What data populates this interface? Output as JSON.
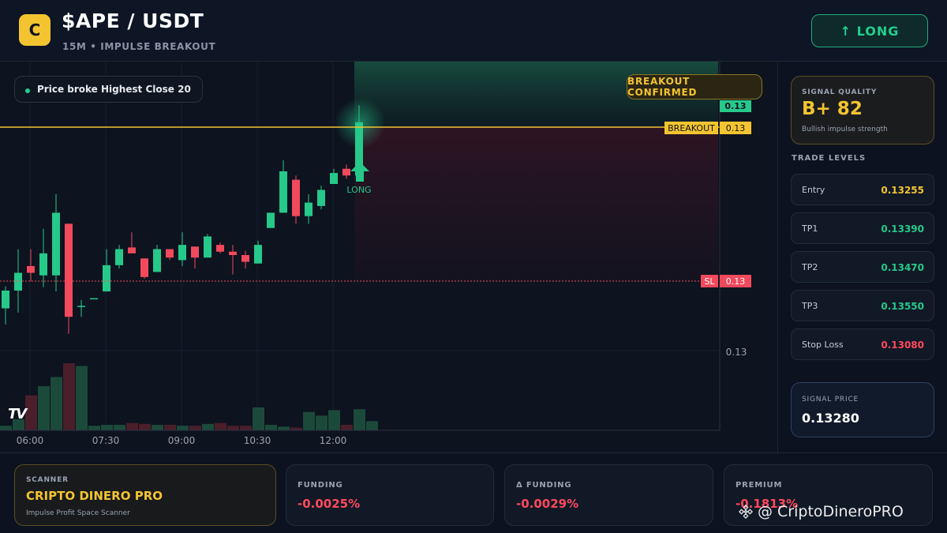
{
  "header": {
    "logo_letter": "C",
    "pair": "$APE / USDT",
    "subtitle": "15M • IMPULSE BREAKOUT",
    "long_button": "↑ LONG"
  },
  "chart": {
    "pill_text": "Price broke Highest Close 20",
    "confirm_badge": "BREAKOUT CONFIRMED",
    "tv_logo": "TV",
    "long_marker": "LONG",
    "price_tag_top": "0.13",
    "breakout_tag": "BREAKOUT",
    "breakout_value": "0.13",
    "sl_tag": "SL",
    "sl_value": "0.13",
    "axis_price": "0.13",
    "time_labels": [
      "06:00",
      "07:30",
      "09:00",
      "10:30",
      "12:00"
    ],
    "colors": {
      "up": "#26c98a",
      "down": "#f2495c",
      "breakout": "#f4c430"
    }
  },
  "chart_data": {
    "type": "candlestick",
    "title": "",
    "interval": "15m",
    "x_ticks": [
      "06:00",
      "07:30",
      "09:00",
      "10:30",
      "12:00"
    ],
    "y_tick": "0.13",
    "breakout_level": 0.13,
    "stop_loss_level": 0.13,
    "candles": [
      {
        "o": 0.13205,
        "h": 0.13231,
        "l": 0.13186,
        "c": 0.13226
      },
      {
        "o": 0.13226,
        "h": 0.13275,
        "l": 0.132,
        "c": 0.13247
      },
      {
        "o": 0.13255,
        "h": 0.13275,
        "l": 0.13237,
        "c": 0.13247
      },
      {
        "o": 0.13244,
        "h": 0.13299,
        "l": 0.1323,
        "c": 0.1327
      },
      {
        "o": 0.13244,
        "h": 0.1334,
        "l": 0.13225,
        "c": 0.13318
      },
      {
        "o": 0.13305,
        "h": 0.13305,
        "l": 0.13175,
        "c": 0.13195
      },
      {
        "o": 0.13208,
        "h": 0.13215,
        "l": 0.13195,
        "c": 0.13208
      },
      {
        "o": 0.13217,
        "h": 0.13217,
        "l": 0.13217,
        "c": 0.13217
      },
      {
        "o": 0.13225,
        "h": 0.13275,
        "l": 0.13225,
        "c": 0.13256
      },
      {
        "o": 0.13256,
        "h": 0.1328,
        "l": 0.13252,
        "c": 0.13275
      },
      {
        "o": 0.13277,
        "h": 0.13295,
        "l": 0.1327,
        "c": 0.1327
      },
      {
        "o": 0.13264,
        "h": 0.13264,
        "l": 0.1324,
        "c": 0.13242
      },
      {
        "o": 0.13248,
        "h": 0.1328,
        "l": 0.13248,
        "c": 0.13275
      },
      {
        "o": 0.13275,
        "h": 0.1327,
        "l": 0.13262,
        "c": 0.13265
      },
      {
        "o": 0.13262,
        "h": 0.13295,
        "l": 0.13255,
        "c": 0.1328
      },
      {
        "o": 0.13278,
        "h": 0.1327,
        "l": 0.13252,
        "c": 0.13265
      },
      {
        "o": 0.13265,
        "h": 0.13293,
        "l": 0.13265,
        "c": 0.1329
      },
      {
        "o": 0.1328,
        "h": 0.13283,
        "l": 0.1327,
        "c": 0.13272
      },
      {
        "o": 0.13272,
        "h": 0.1328,
        "l": 0.13245,
        "c": 0.13268
      },
      {
        "o": 0.13268,
        "h": 0.13273,
        "l": 0.13252,
        "c": 0.1326
      },
      {
        "o": 0.13258,
        "h": 0.13285,
        "l": 0.13258,
        "c": 0.1328
      },
      {
        "o": 0.133,
        "h": 0.13318,
        "l": 0.133,
        "c": 0.13318
      },
      {
        "o": 0.13318,
        "h": 0.1338,
        "l": 0.13318,
        "c": 0.13367
      },
      {
        "o": 0.13357,
        "h": 0.13362,
        "l": 0.13305,
        "c": 0.13314
      },
      {
        "o": 0.13314,
        "h": 0.1334,
        "l": 0.13305,
        "c": 0.1333
      },
      {
        "o": 0.13326,
        "h": 0.1335,
        "l": 0.13322,
        "c": 0.13345
      },
      {
        "o": 0.13352,
        "h": 0.1337,
        "l": 0.13352,
        "c": 0.13365
      },
      {
        "o": 0.1337,
        "h": 0.13375,
        "l": 0.13358,
        "c": 0.13362
      },
      {
        "o": 0.13362,
        "h": 0.13445,
        "l": 0.13362,
        "c": 0.13425
      }
    ],
    "volumes": [
      5,
      12,
      38,
      48,
      58,
      73,
      70,
      5,
      6,
      6,
      8,
      7,
      6,
      6,
      5,
      5,
      7,
      8,
      5,
      5,
      25,
      6,
      4,
      3,
      20,
      16,
      22,
      6,
      23,
      10
    ]
  },
  "panel": {
    "quality_label": "SIGNAL QUALITY",
    "quality_grade": "B+ 82",
    "quality_desc": "Bullish impulse strength",
    "levels_title": "TRADE LEVELS",
    "levels": [
      {
        "name": "Entry",
        "value": "0.13255",
        "color": "#f4c430"
      },
      {
        "name": "TP1",
        "value": "0.13390",
        "color": "#26c98a"
      },
      {
        "name": "TP2",
        "value": "0.13470",
        "color": "#26c98a"
      },
      {
        "name": "TP3",
        "value": "0.13550",
        "color": "#26c98a"
      },
      {
        "name": "Stop Loss",
        "value": "0.13080",
        "color": "#ff4a5c"
      }
    ],
    "signal_price_label": "SIGNAL PRICE",
    "signal_price": "0.13280"
  },
  "bottom": {
    "scanner_label": "SCANNER",
    "scanner_name": "CRIPTO DINERO PRO",
    "scanner_desc": "Impulse Profit Space Scanner",
    "stats": [
      {
        "label": "FUNDING",
        "value": "-0.0025%"
      },
      {
        "label": "Δ FUNDING",
        "value": "-0.0029%"
      },
      {
        "label": "PREMIUM",
        "value": "-0.1813%"
      }
    ],
    "watermark": "@ CriptoDineroPRO"
  }
}
